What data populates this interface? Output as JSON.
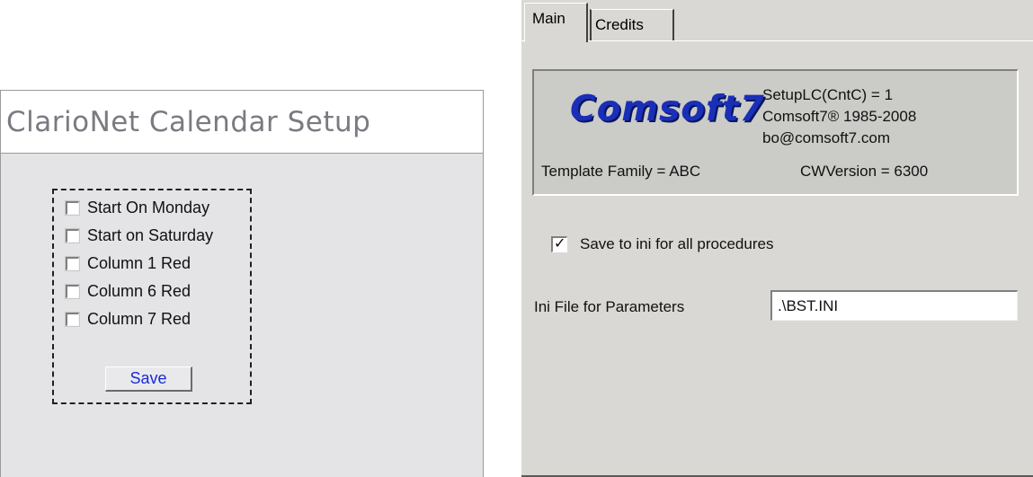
{
  "left": {
    "title": "ClarioNet Calendar Setup",
    "options": [
      {
        "label": "Start On Monday",
        "checked": false
      },
      {
        "label": "Start on Saturday",
        "checked": false
      },
      {
        "label": "Column 1 Red",
        "checked": false
      },
      {
        "label": "Column 6 Red",
        "checked": false
      },
      {
        "label": "Column 7 Red",
        "checked": false
      }
    ],
    "save_label": "Save",
    "colors": {
      "title": "#7a7a82",
      "save_text": "#1a2bd8",
      "panel_bg": "#e4e4e7"
    }
  },
  "right": {
    "tabs": [
      {
        "label": "Main",
        "active": true
      },
      {
        "label": "Credits",
        "active": false
      }
    ],
    "info": {
      "logo": "Comsoft7",
      "lines": [
        "SetupLC(CntC) = 1",
        "Comsoft7® 1985-2008",
        "bo@comsoft7.com"
      ],
      "template_family": "Template Family = ABC",
      "cw_version": "CWVersion = 6300"
    },
    "save_ini": {
      "label": "Save to ini for all procedures",
      "checked": true
    },
    "ini_file": {
      "label": "Ini File for Parameters",
      "value": ".\\BST.INI"
    },
    "colors": {
      "logo": "#1a2fb8",
      "panel_bg": "#d9d8d4"
    }
  }
}
